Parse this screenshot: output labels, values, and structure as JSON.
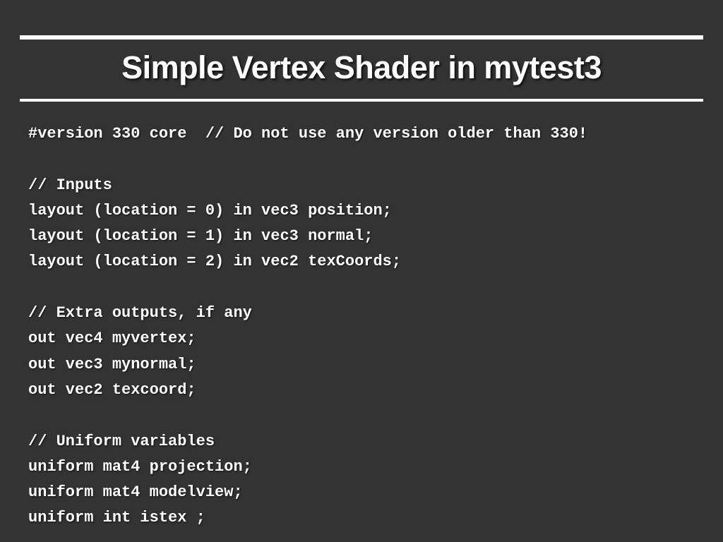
{
  "title": "Simple Vertex Shader in mytest3",
  "code_lines": [
    "#version 330 core  // Do not use any version older than 330!",
    "",
    "// Inputs",
    "layout (location = 0) in vec3 position;",
    "layout (location = 1) in vec3 normal;",
    "layout (location = 2) in vec2 texCoords;",
    "",
    "// Extra outputs, if any",
    "out vec4 myvertex;",
    "out vec3 mynormal;",
    "out vec2 texcoord;",
    "",
    "// Uniform variables",
    "uniform mat4 projection;",
    "uniform mat4 modelview;",
    "uniform int istex ;"
  ]
}
